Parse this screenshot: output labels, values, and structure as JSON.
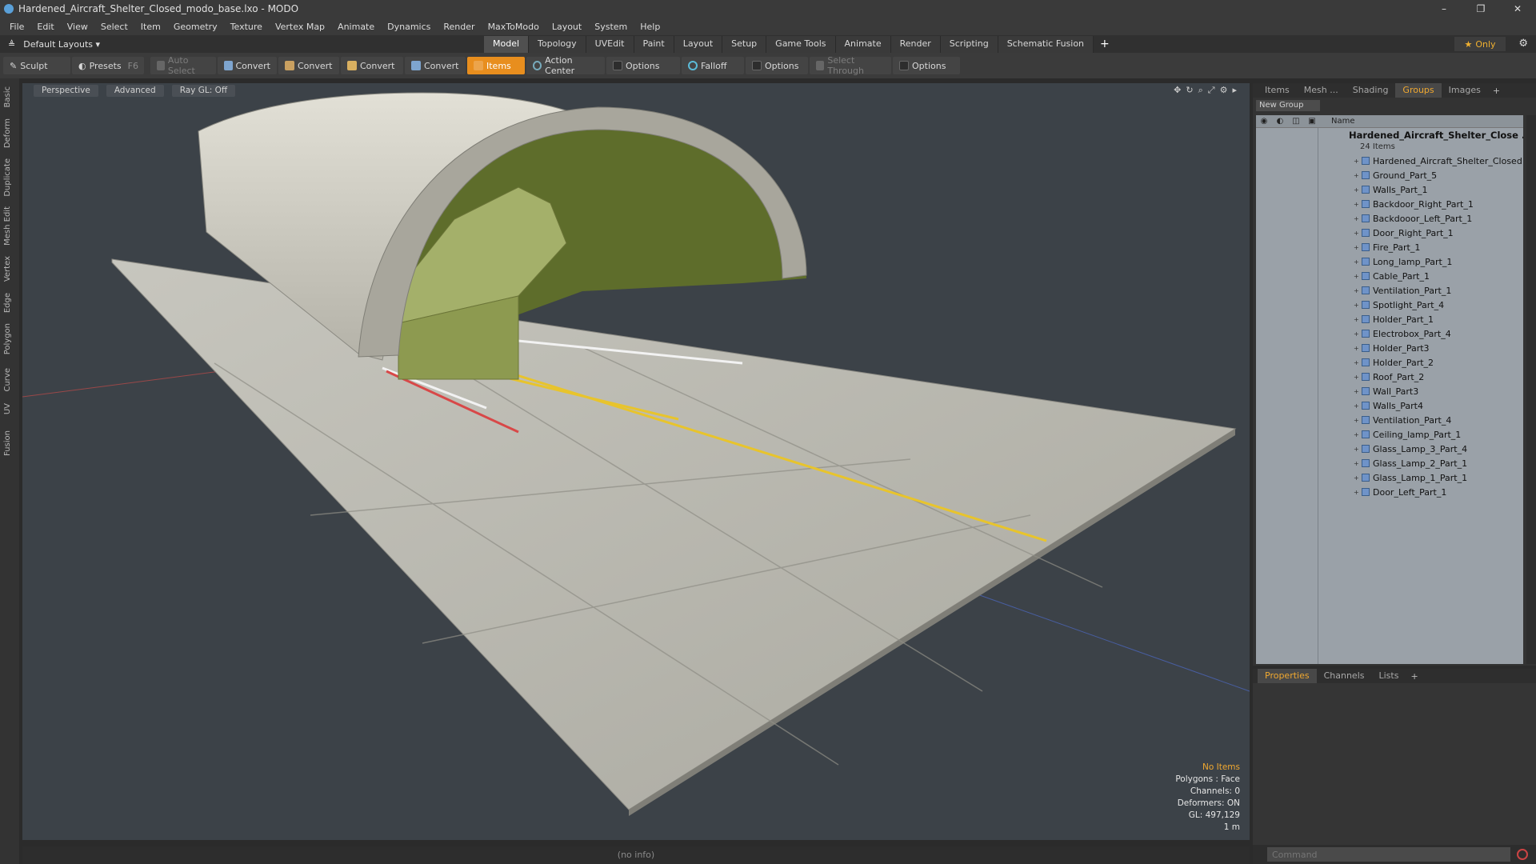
{
  "window": {
    "title": "Hardened_Aircraft_Shelter_Closed_modo_base.lxo - MODO",
    "controls": [
      "–",
      "❐",
      "✕"
    ]
  },
  "menu": [
    "File",
    "Edit",
    "View",
    "Select",
    "Item",
    "Geometry",
    "Texture",
    "Vertex Map",
    "Animate",
    "Dynamics",
    "Render",
    "MaxToModo",
    "Layout",
    "System",
    "Help"
  ],
  "layout_selector": "Default Layouts ▾",
  "tabs": [
    "Model",
    "Topology",
    "UVEdit",
    "Paint",
    "Layout",
    "Setup",
    "Game Tools",
    "Animate",
    "Render",
    "Scripting",
    "Schematic Fusion"
  ],
  "active_tab": "Model",
  "only_label": "Only",
  "toolbar": {
    "sculpt": "Sculpt",
    "presets": "Presets",
    "presets_key": "F6",
    "auto_select": "Auto Select",
    "convert": "Convert",
    "items": "Items",
    "action_center": "Action Center",
    "options": "Options",
    "falloff": "Falloff",
    "select_through": "Select Through"
  },
  "left_tabs": [
    "Basic",
    "Deform",
    "Duplicate",
    "Mesh Edit",
    "Vertex",
    "Edge",
    "Polygon",
    "Curve",
    "UV",
    "Fusion"
  ],
  "viewport": {
    "perspective": "Perspective",
    "advanced": "Advanced",
    "raygl": "Ray GL: Off",
    "info": {
      "no_items": "No Items",
      "polygons": "Polygons : Face",
      "channels": "Channels: 0",
      "deformers": "Deformers: ON",
      "gl": "GL: 497,129",
      "scale": "1 m"
    }
  },
  "status": "(no info)",
  "right_tabs": [
    "Items",
    "Mesh ...",
    "Shading",
    "Groups",
    "Images"
  ],
  "active_right_tab": "Groups",
  "new_group": "New Group",
  "name_header": "Name",
  "group": {
    "name": "Hardened_Aircraft_Shelter_Close ...",
    "count": "24 Items"
  },
  "items": [
    "Hardened_Aircraft_Shelter_Closed",
    "Ground_Part_5",
    "Walls_Part_1",
    "Backdoor_Right_Part_1",
    "Backdooor_Left_Part_1",
    "Door_Right_Part_1",
    "Fire_Part_1",
    "Long_lamp_Part_1",
    "Cable_Part_1",
    "Ventilation_Part_1",
    "Spotlight_Part_4",
    "Holder_Part_1",
    "Electrobox_Part_4",
    "Holder_Part3",
    "Holder_Part_2",
    "Roof_Part_2",
    "Wall_Part3",
    "Walls_Part4",
    "Ventilation_Part_4",
    "Ceiling_lamp_Part_1",
    "Glass_Lamp_3_Part_4",
    "Glass_Lamp_2_Part_1",
    "Glass_Lamp_1_Part_1",
    "Door_Left_Part_1"
  ],
  "bottom_tabs": [
    "Properties",
    "Channels",
    "Lists"
  ],
  "command_placeholder": "Command"
}
